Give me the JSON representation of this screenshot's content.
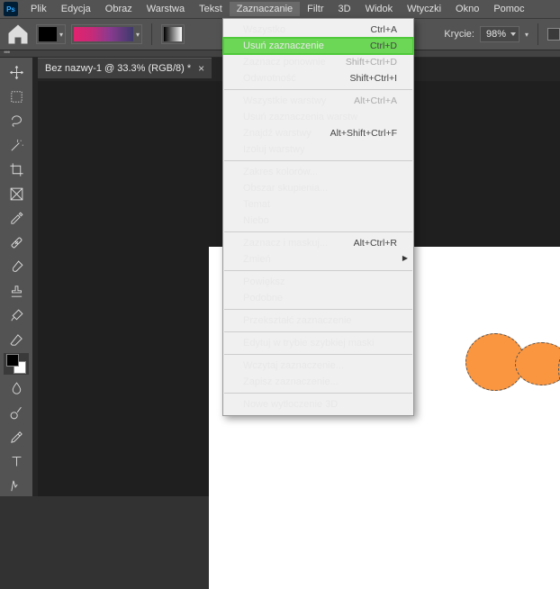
{
  "menubar": {
    "items": [
      "Plik",
      "Edycja",
      "Obraz",
      "Warstwa",
      "Tekst",
      "Zaznaczanie",
      "Filtr",
      "3D",
      "Widok",
      "Wtyczki",
      "Okno",
      "Pomoc"
    ],
    "open_index": 5
  },
  "optbar": {
    "opacity_label": "Krycie:",
    "opacity_value": "98%"
  },
  "tab": {
    "title": "Bez nazwy-1 @ 33.3% (RGB/8) *"
  },
  "dropdown": {
    "groups": [
      [
        {
          "label": "Wszystko",
          "shortcut": "Ctrl+A"
        },
        {
          "label": "Usuń zaznaczenie",
          "shortcut": "Ctrl+D",
          "highlight": true
        },
        {
          "label": "Zaznacz ponownie",
          "shortcut": "Shift+Ctrl+D",
          "disabled": true
        },
        {
          "label": "Odwrotność",
          "shortcut": "Shift+Ctrl+I"
        }
      ],
      [
        {
          "label": "Wszystkie warstwy",
          "shortcut": "Alt+Ctrl+A",
          "disabled": true
        },
        {
          "label": "Usuń zaznaczenia warstw",
          "disabled": true
        },
        {
          "label": "Znajdź warstwy",
          "shortcut": "Alt+Shift+Ctrl+F"
        },
        {
          "label": "Izoluj warstwy",
          "disabled": true
        }
      ],
      [
        {
          "label": "Zakres kolorów..."
        },
        {
          "label": "Obszar skupienia..."
        },
        {
          "label": "Temat"
        },
        {
          "label": "Niebo"
        }
      ],
      [
        {
          "label": "Zaznacz i maskuj...",
          "shortcut": "Alt+Ctrl+R"
        },
        {
          "label": "Zmień",
          "sub": true
        }
      ],
      [
        {
          "label": "Powiększ"
        },
        {
          "label": "Podobne"
        }
      ],
      [
        {
          "label": "Przekształć zaznaczenie"
        }
      ],
      [
        {
          "label": "Edytuj w trybie szybkiej maski"
        }
      ],
      [
        {
          "label": "Wczytaj zaznaczenie...",
          "disabled": true
        },
        {
          "label": "Zapisz zaznaczenie..."
        }
      ],
      [
        {
          "label": "Nowe wytłoczenie 3D",
          "disabled": true
        }
      ]
    ]
  },
  "tools": [
    "move",
    "marquee",
    "lasso",
    "wand",
    "crop",
    "frame",
    "eyedrop",
    "heal",
    "brush",
    "stamp",
    "history",
    "eraser",
    "gradient",
    "blur",
    "dodge",
    "pen",
    "type",
    "path"
  ]
}
